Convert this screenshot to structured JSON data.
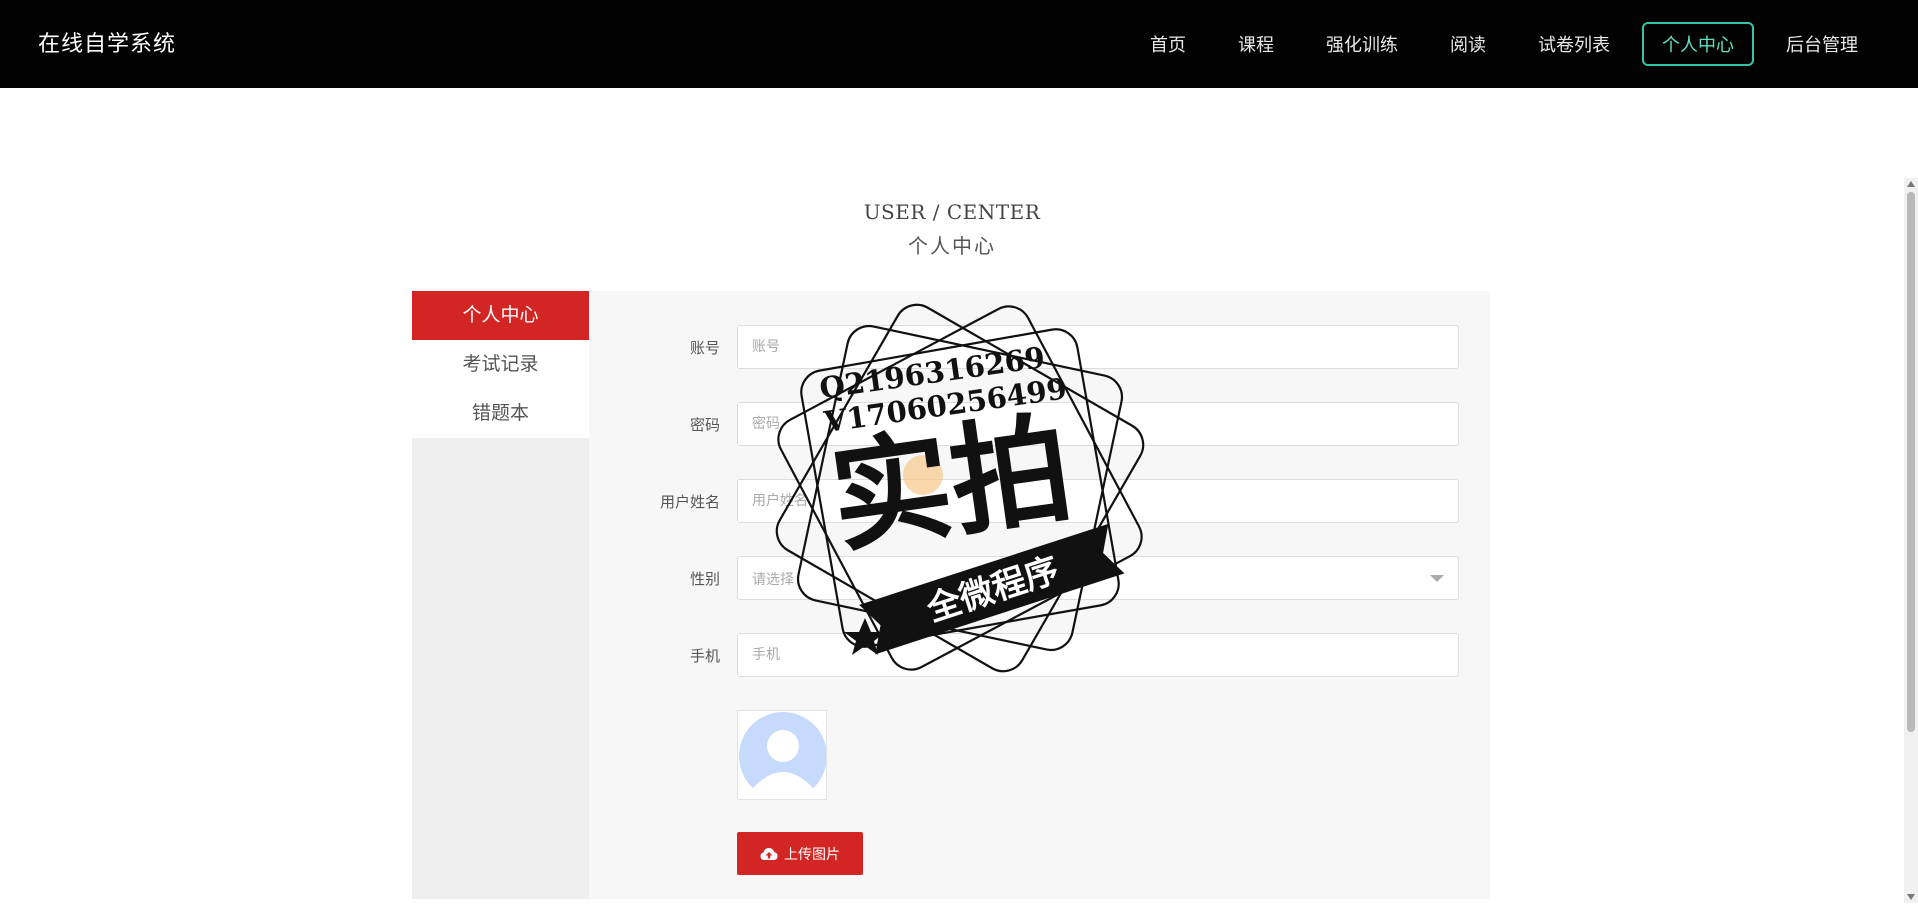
{
  "app": {
    "title": "在线自学系统"
  },
  "nav": {
    "items": [
      {
        "label": "首页",
        "active": false
      },
      {
        "label": "课程",
        "active": false
      },
      {
        "label": "强化训练",
        "active": false
      },
      {
        "label": "阅读",
        "active": false
      },
      {
        "label": "试卷列表",
        "active": false
      },
      {
        "label": "个人中心",
        "active": true
      },
      {
        "label": "后台管理",
        "active": false
      }
    ],
    "active_color": "#36c3a8"
  },
  "section": {
    "title_en": "USER / CENTER",
    "title_zh": "个人中心"
  },
  "sidebar": {
    "items": [
      {
        "label": "个人中心",
        "active": true
      },
      {
        "label": "考试记录",
        "active": false
      },
      {
        "label": "错题本",
        "active": false
      }
    ],
    "active_color": "#d32624"
  },
  "form": {
    "account": {
      "label": "账号",
      "placeholder": "账号"
    },
    "password": {
      "label": "密码",
      "placeholder": "密码"
    },
    "username": {
      "label": "用户姓名",
      "placeholder": "用户姓名"
    },
    "gender": {
      "label": "性别",
      "placeholder": "请选择"
    },
    "phone": {
      "label": "手机",
      "placeholder": "手机"
    },
    "avatar": {
      "icon": "user-avatar-placeholder"
    },
    "upload_label": "上传图片"
  },
  "watermark": {
    "line1": "Q2196316269",
    "line2": "V17060256499",
    "main": "实拍",
    "banner": "全微程序"
  }
}
